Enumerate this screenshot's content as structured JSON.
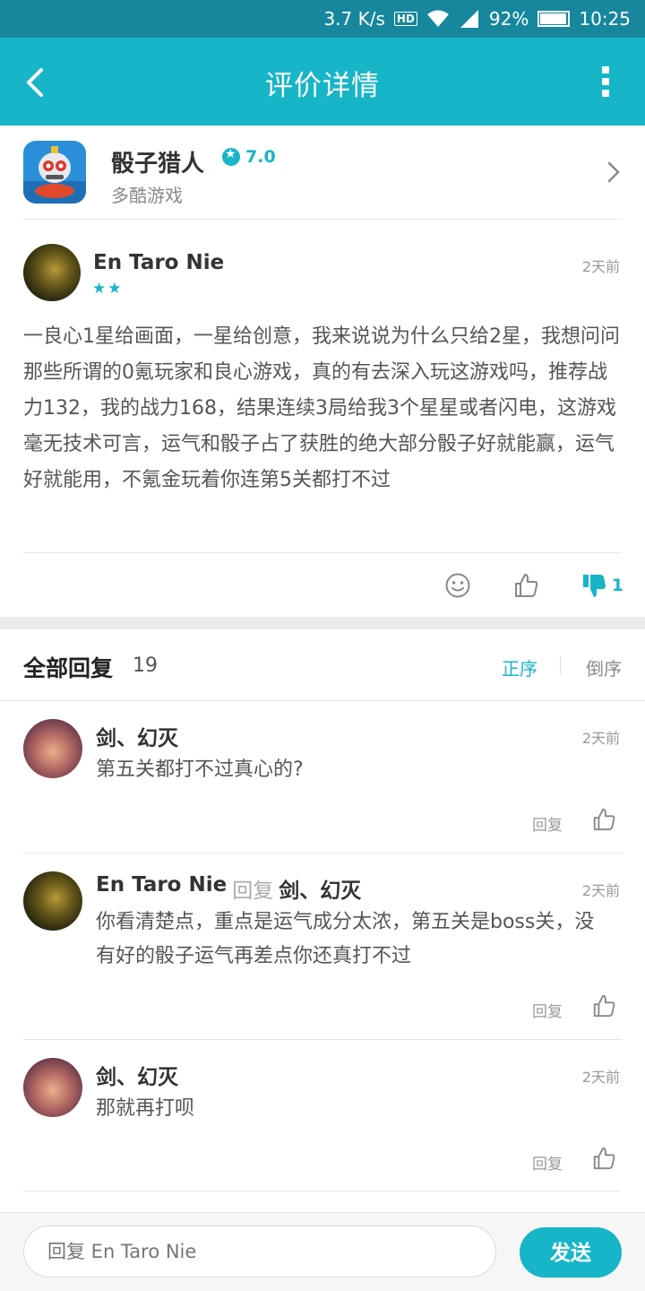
{
  "status_bar": {
    "speed": "3.7 K/s",
    "hd": "HD",
    "battery": "92%",
    "time": "10:25"
  },
  "header": {
    "title": "评价详情"
  },
  "game": {
    "name": "骰子猎人",
    "score": "7.0",
    "developer": "多酷游戏"
  },
  "review": {
    "author": "En Taro Nie",
    "stars": "★★",
    "time": "2天前",
    "body": "一良心1星给画面，一星给创意，我来说说为什么只给2星，我想问问那些所谓的0氪玩家和良心游戏，真的有去深入玩这游戏吗，推荐战力132，我的战力168，结果连续3局给我3个星星或者闪电，这游戏毫无技术可言，运气和骰子占了获胜的绝大部分骰子好就能赢，运气好就能用，不氪金玩着你连第5关都打不过",
    "dislike_count": "1"
  },
  "replies": {
    "title": "全部回复",
    "count": "19",
    "sort_asc": "正序",
    "sort_desc": "倒序",
    "reply_label": "回复",
    "items": [
      {
        "author": "剑、幻灭",
        "time": "2天前",
        "text": "第五关都打不过真心的?"
      },
      {
        "author": "En Taro Nie",
        "reply_to": "剑、幻灭",
        "time": "2天前",
        "text": "你看清楚点，重点是运气成分太浓，第五关是boss关，没有好的骰子运气再差点你还真打不过"
      },
      {
        "author": "剑、幻灭",
        "time": "2天前",
        "text": "那就再打呗"
      }
    ]
  },
  "composer": {
    "placeholder": "回复 En Taro Nie",
    "send_label": "发送"
  }
}
